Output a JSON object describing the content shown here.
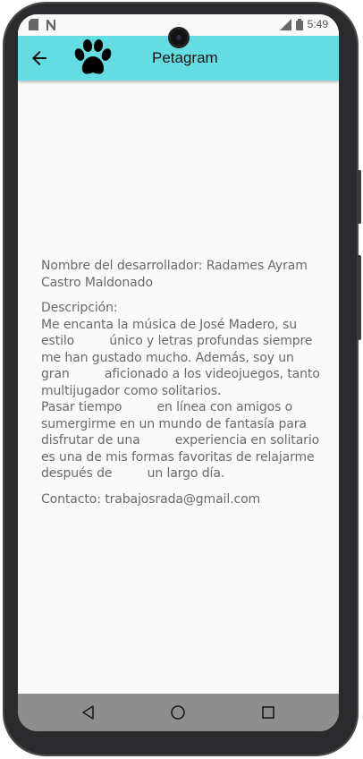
{
  "status_bar": {
    "time": "5:49",
    "left_icons": [
      "sd-card-icon",
      "notification-n-icon"
    ],
    "right_icons": [
      "signal-icon",
      "battery-icon"
    ]
  },
  "app_bar": {
    "title": "Petagram",
    "background": "#63dce2",
    "back_icon": "arrow-back-icon",
    "logo_icon": "paw-icon"
  },
  "content": {
    "developer": "Nombre del desarrollador: Radames Ayram Castro Maldonado",
    "description": "Descripción:\nMe encanta la música de José Madero, su estilo         único y letras profundas siempre me han gustado mucho. Además, soy un gran         aficionado a los videojuegos, tanto multijugador como solitarios.\nPasar tiempo         en línea con amigos o sumergirme en un mundo de fantasía para disfrutar de una         experiencia en solitario es una de mis formas favoritas de relajarme después de         un largo día.",
    "contact": "Contacto: trabajosrada@gmail.com"
  },
  "nav_bar": {
    "buttons": [
      "back-triangle-icon",
      "home-circle-icon",
      "recents-square-icon"
    ]
  }
}
